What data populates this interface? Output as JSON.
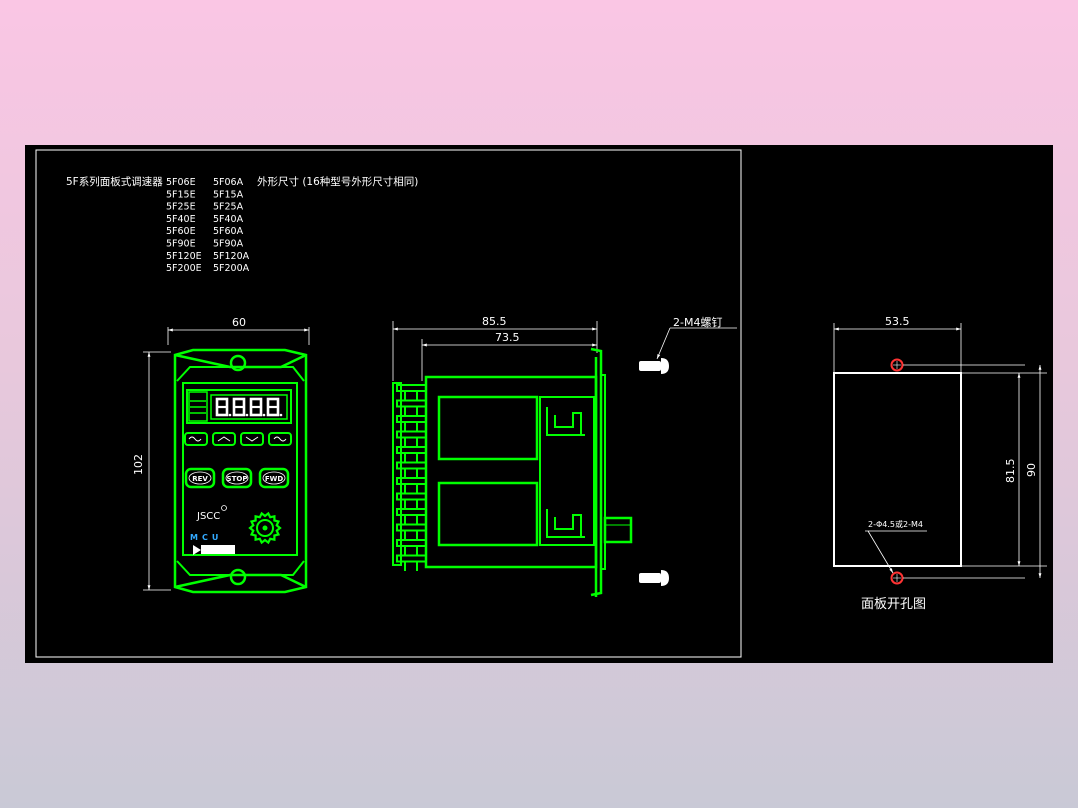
{
  "drawing": {
    "title": "5F系列面板式调速器",
    "models_e": [
      "5F06E",
      "5F15E",
      "5F25E",
      "5F40E",
      "5F60E",
      "5F90E",
      "5F120E",
      "5F200E"
    ],
    "models_a": [
      "5F06A",
      "5F15A",
      "5F25A",
      "5F40A",
      "5F60A",
      "5F90A",
      "5F120A",
      "5F200A"
    ],
    "subtitle": "外形尺寸 (16种型号外形尺寸相同)"
  },
  "front_view": {
    "width_label": "60",
    "height_label": "102",
    "display_digits": "8.8.8.8.",
    "buttons": [
      "REV",
      "STOP",
      "FWD"
    ],
    "brand": "JSCC",
    "logo": "MCU"
  },
  "side_view": {
    "overall_width_label": "85.5",
    "body_width_label": "73.5",
    "screw_label": "2-M4螺钉"
  },
  "cutout_view": {
    "width_label": "53.5",
    "hole_pitch_label": "81.5",
    "height_label": "90",
    "hole_label": "2-Φ4.5或2-M4",
    "caption": "面板开孔图"
  },
  "colors": {
    "outline": "#00ff00",
    "lines": "#ffffff",
    "holes": "#ff3333",
    "background": "#000000"
  }
}
